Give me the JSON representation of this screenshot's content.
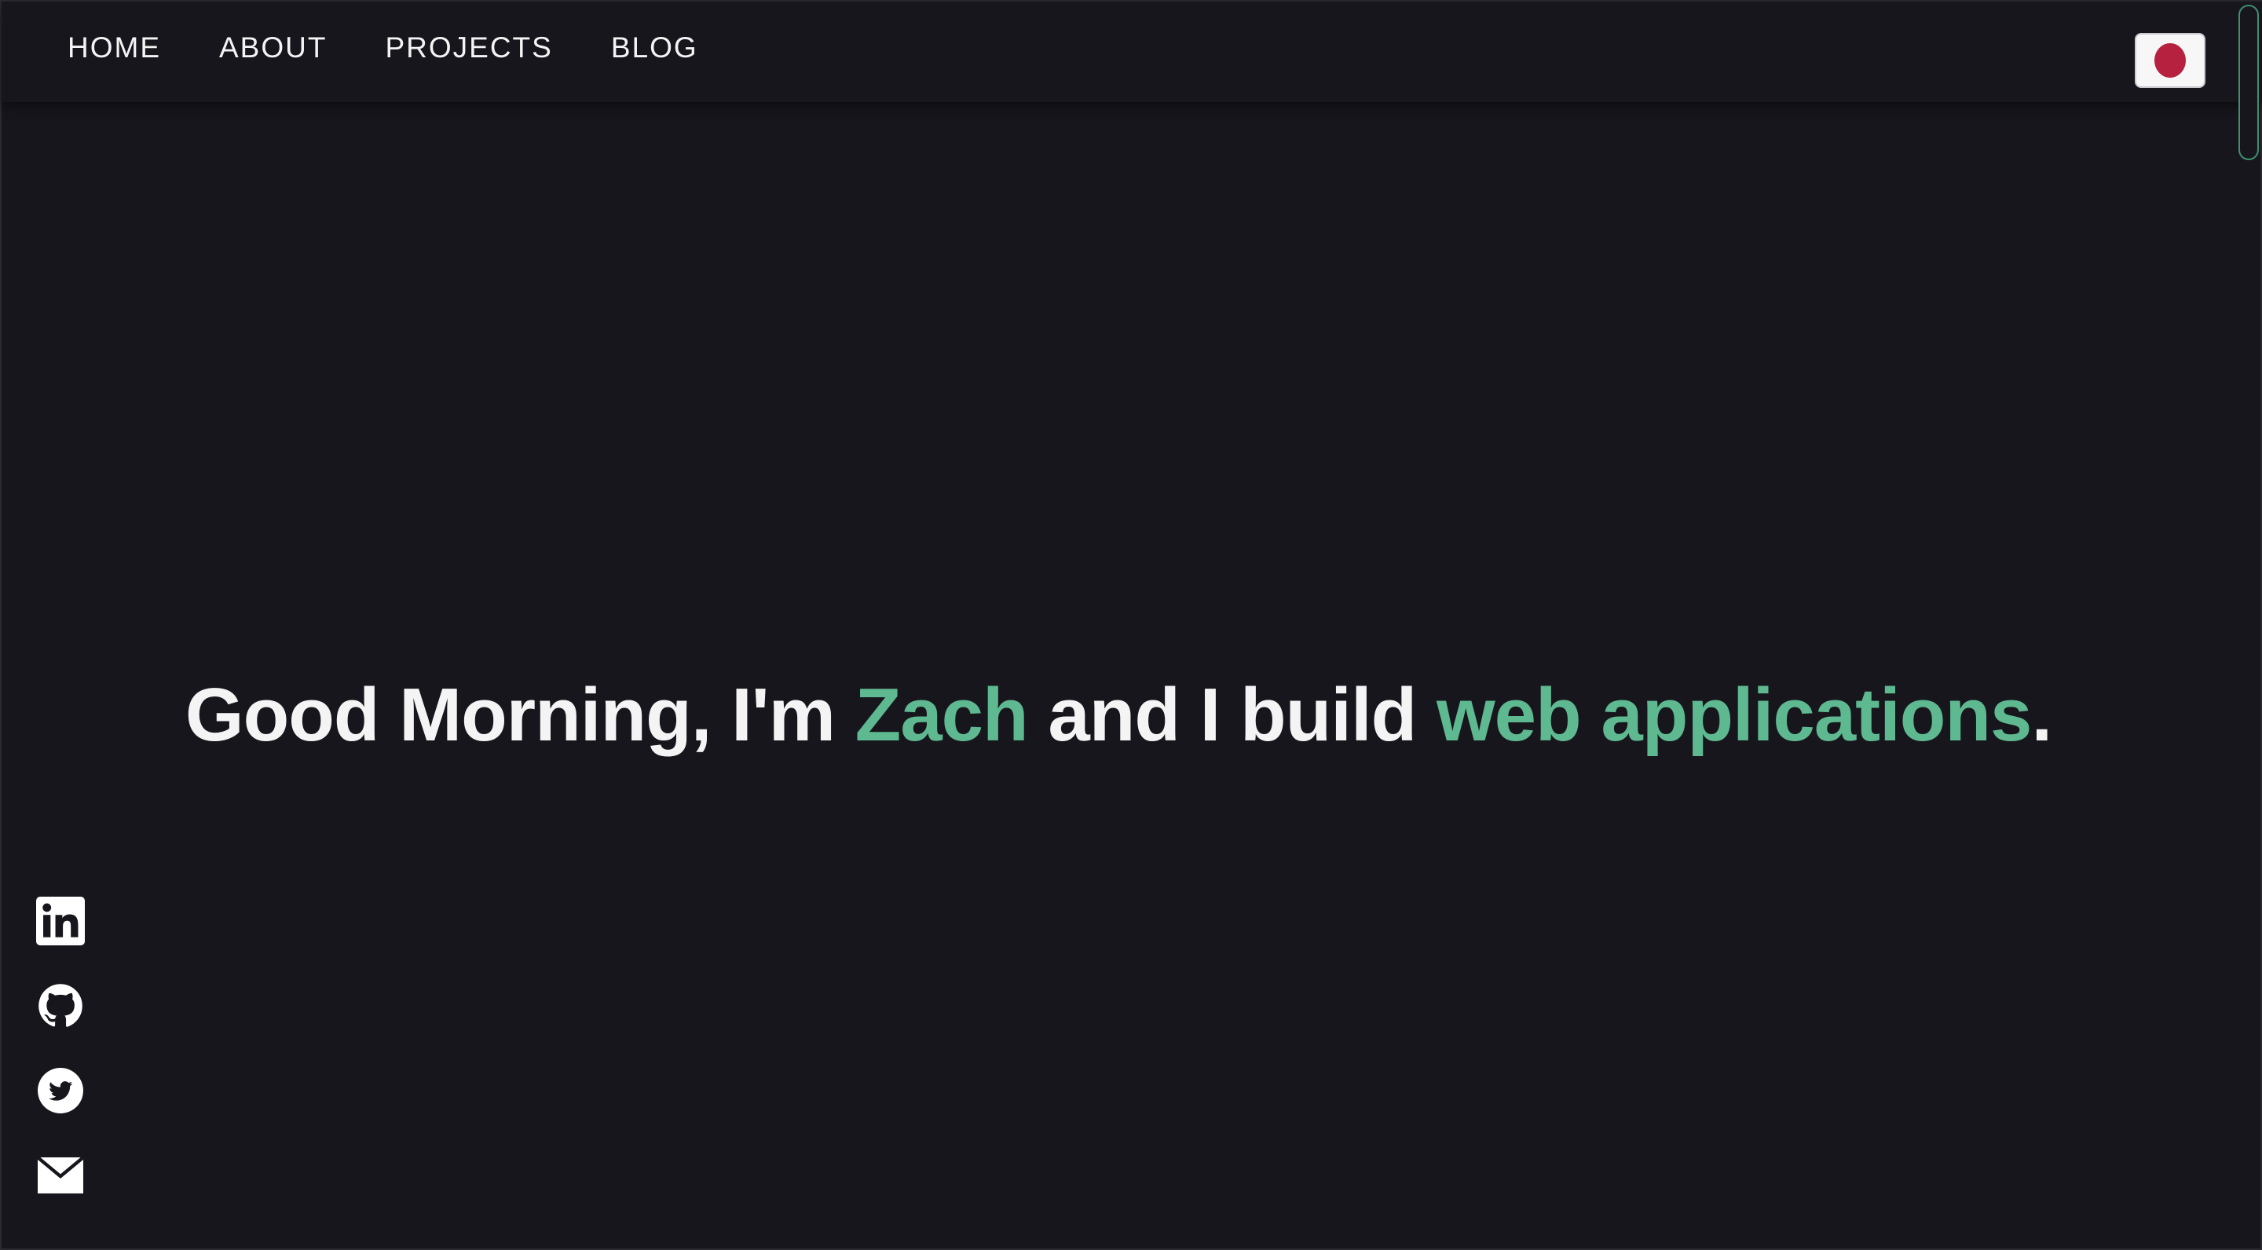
{
  "nav": {
    "items": [
      {
        "label": "HOME"
      },
      {
        "label": "ABOUT"
      },
      {
        "label": "PROJECTS"
      },
      {
        "label": "BLOG"
      }
    ]
  },
  "language_toggle": {
    "icon": "japan-flag-icon"
  },
  "hero": {
    "part1": "Good Morning, I'm ",
    "name": "Zach",
    "part2": " and I build ",
    "highlight": "web applications",
    "part3": "."
  },
  "social": [
    {
      "icon": "linkedin-icon"
    },
    {
      "icon": "github-icon"
    },
    {
      "icon": "twitter-icon"
    },
    {
      "icon": "email-icon"
    }
  ],
  "colors": {
    "background": "#17161d",
    "text": "#f4f4f5",
    "accent": "#5eb890",
    "flag_red": "#b5213f"
  }
}
